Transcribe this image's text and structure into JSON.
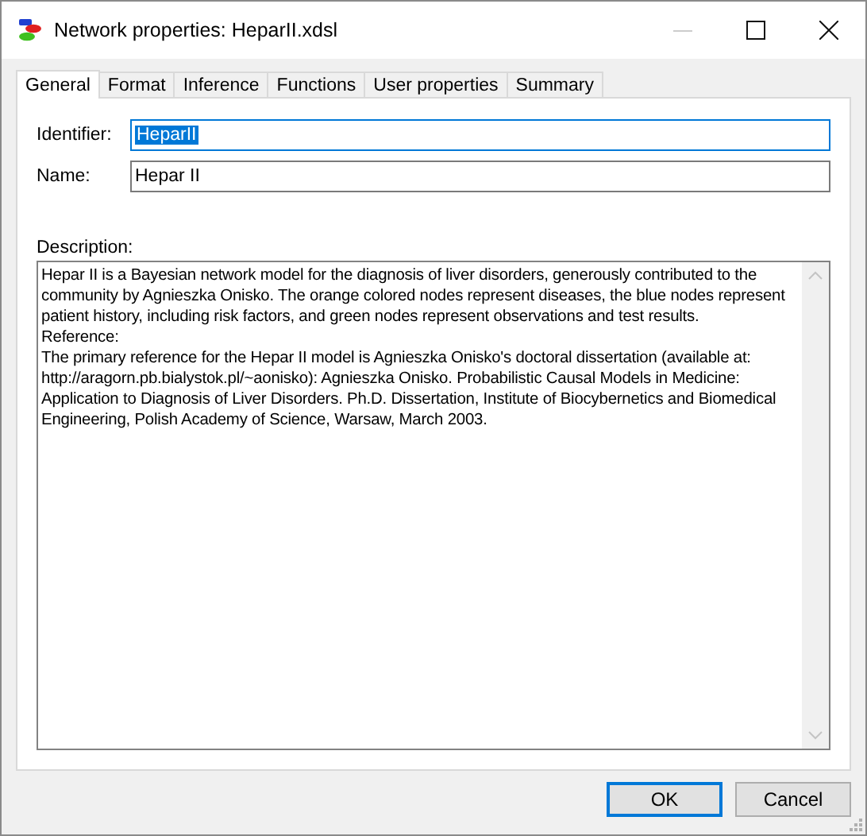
{
  "window": {
    "title": "Network properties: HeparII.xdsl"
  },
  "tabs": [
    {
      "label": "General",
      "selected": true
    },
    {
      "label": "Format",
      "selected": false
    },
    {
      "label": "Inference",
      "selected": false
    },
    {
      "label": "Functions",
      "selected": false
    },
    {
      "label": "User properties",
      "selected": false
    },
    {
      "label": "Summary",
      "selected": false
    }
  ],
  "fields": [
    {
      "label": "Identifier:",
      "value": "HeparII",
      "selected": true
    },
    {
      "label": "Name:",
      "value": "Hepar II",
      "selected": false
    }
  ],
  "description": {
    "label": "Description:",
    "paragraphs": [
      "Hepar II is a Bayesian network model for the diagnosis of liver disorders, generously contributed to the community by Agnieszka Onisko. The orange colored nodes represent diseases, the blue nodes represent patient history, including risk factors, and green nodes represent observations and test results.",
      "Reference:",
      "The primary reference for the Hepar II model is Agnieszka Onisko's doctoral dissertation (available at: http://aragorn.pb.bialystok.pl/~aonisko): Agnieszka Onisko. Probabilistic Causal Models in Medicine: Application to Diagnosis of Liver Disorders. Ph.D. Dissertation, Institute of Biocybernetics and Biomedical Engineering, Polish Academy of Science, Warsaw, March 2003."
    ]
  },
  "buttons": [
    {
      "label": "OK",
      "default": true
    },
    {
      "label": "Cancel",
      "default": false
    }
  ]
}
